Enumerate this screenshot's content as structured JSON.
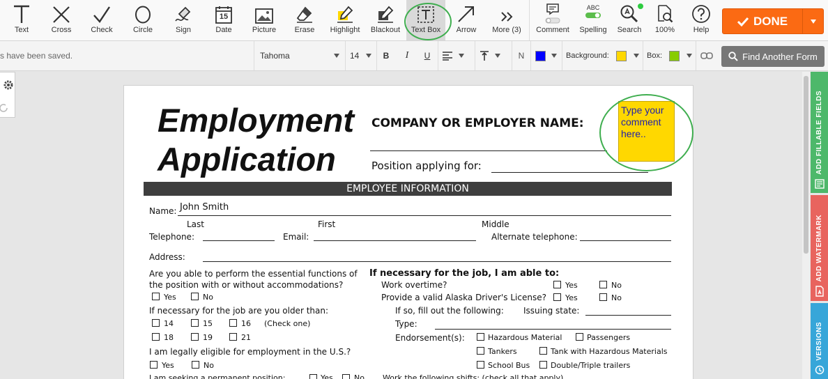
{
  "toolbar": {
    "tools": [
      {
        "label": "Text",
        "icon": "text-icon"
      },
      {
        "label": "Cross",
        "icon": "cross-icon"
      },
      {
        "label": "Check",
        "icon": "check-icon"
      },
      {
        "label": "Circle",
        "icon": "circle-icon"
      },
      {
        "label": "Sign",
        "icon": "sign-icon"
      },
      {
        "label": "Date",
        "icon": "date-icon"
      },
      {
        "label": "Picture",
        "icon": "picture-icon"
      },
      {
        "label": "Erase",
        "icon": "erase-icon"
      },
      {
        "label": "Highlight",
        "icon": "highlight-icon"
      },
      {
        "label": "Blackout",
        "icon": "blackout-icon"
      },
      {
        "label": "Text Box",
        "icon": "text-box-icon",
        "active": true
      },
      {
        "label": "Arrow",
        "icon": "arrow-icon"
      },
      {
        "label": "More (3)",
        "icon": "more-icon"
      },
      {
        "label": "Comment",
        "icon": "comment-icon"
      },
      {
        "label": "Spelling",
        "icon": "spelling-icon",
        "badge": "ABC"
      },
      {
        "label": "Search",
        "icon": "search-icon"
      },
      {
        "label": "100%",
        "icon": "zoom-icon"
      },
      {
        "label": "Help",
        "icon": "help-icon"
      }
    ],
    "date_icon_day": "15",
    "done_label": "DONE"
  },
  "format": {
    "status": "s have been saved.",
    "font": "Tahoma",
    "size": "14",
    "bold": "B",
    "italic": "I",
    "underline": "U",
    "n_label": "N",
    "background_label": "Background:",
    "box_label": "Box:",
    "text_color": "#0000ff",
    "background_color": "#ffd800",
    "box_color": "#88cc00",
    "find_label": "Find Another Form"
  },
  "sidebar": {
    "tabs": [
      {
        "label": "ADD FILLABLE FIELDS",
        "color": "#4db86a"
      },
      {
        "label": "ADD WATERMARK",
        "color": "#e8645e"
      },
      {
        "label": "VERSIONS",
        "color": "#37a6d9"
      }
    ]
  },
  "doc": {
    "title1": "Employment",
    "title2": "Application",
    "company_label": "COMPANY OR EMPLOYER NAME:",
    "position_label": "Position applying for:",
    "comment_text": "Type your comment here..",
    "section": "EMPLOYEE INFORMATION",
    "name_label": "Name:",
    "name_value": "John Smith",
    "last": "Last",
    "first": "First",
    "middle": "Middle",
    "telephone": "Telephone:",
    "email": "Email:",
    "alt_tel": "Alternate telephone:",
    "address": "Address:",
    "q1a": "Are you able to perform the essential functions of",
    "q1b": "the position with or without accommodations?",
    "yes": "Yes",
    "no": "No",
    "q2": "If necessary for the job are you older than:",
    "ages": [
      "14",
      "15",
      "16",
      "18",
      "19",
      "21"
    ],
    "check_one": "(Check one)",
    "q3": "I am legally eligible for employment in the U.S.?",
    "q4": "I am seeking a permanent position:",
    "r_head": "If necessary for the job, I am able to:",
    "overtime": "Work overtime?",
    "license": "Provide a valid Alaska Driver's License?",
    "fill": "If so, fill out the following:",
    "issuing": "Issuing state:",
    "type": "Type:",
    "endorse": "Endorsement(s):",
    "hazmat": "Hazardous Material",
    "passengers": "Passengers",
    "tankers": "Tankers",
    "tankhaz": "Tank with Hazardous Materials",
    "schoolbus": "School Bus",
    "trailers": "Double/Triple trailers",
    "shifts": "Work the following shifts: (check all that apply)"
  }
}
